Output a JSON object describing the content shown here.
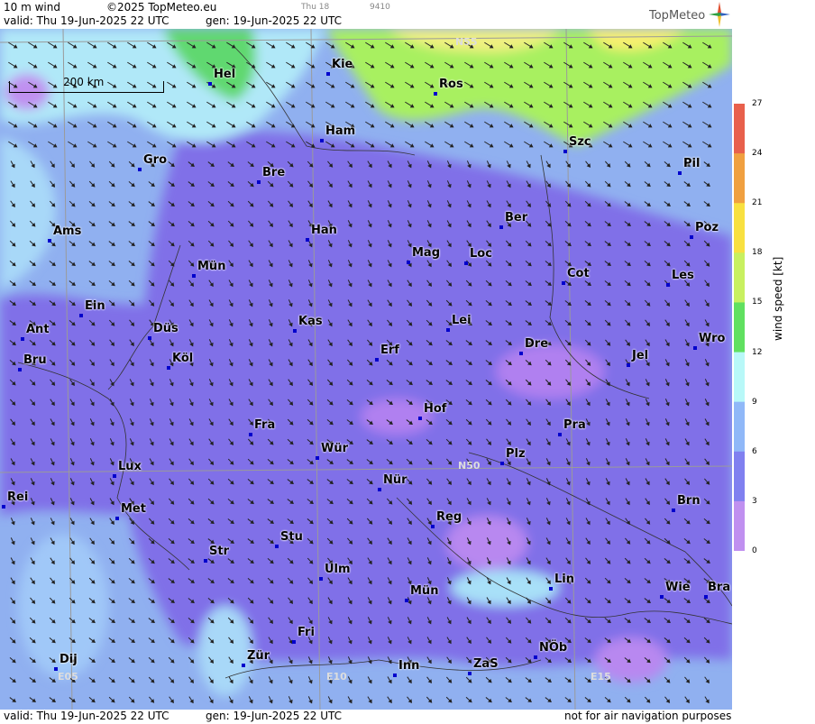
{
  "header": {
    "product": "10 m wind",
    "copyright": "©2025 TopMeteo.eu",
    "run_small": "Thu 18",
    "code_small": "9410",
    "valid": "valid:  Thu  19-Jun-2025  22 UTC",
    "gen": "gen: 19-Jun-2025 22 UTC",
    "brand": "TopMeteo"
  },
  "footer": {
    "valid": "valid:  Thu  19-Jun-2025  22 UTC",
    "gen": "gen: 19-Jun-2025 22 UTC",
    "disclaimer": "not for air navigation purposes"
  },
  "scale": {
    "label": "200 km"
  },
  "grid_labels": {
    "n55": "N55",
    "n50": "N50",
    "e05": "E05",
    "e10": "E10",
    "e15": "E15"
  },
  "legend": {
    "title": "wind speed  [kt]",
    "ticks": [
      "27",
      "24",
      "21",
      "18",
      "15",
      "12",
      "9",
      "6",
      "3",
      "0"
    ],
    "colors": [
      "#e8604c",
      "#f0a040",
      "#f8e040",
      "#c8f060",
      "#60e060",
      "#b8f8f8",
      "#90b8f8",
      "#8080f0",
      "#c090f0"
    ]
  },
  "cities": [
    {
      "name": "Hel"
    },
    {
      "name": "Kie"
    },
    {
      "name": "Ros"
    },
    {
      "name": "Ham"
    },
    {
      "name": "Szc"
    },
    {
      "name": "Gro"
    },
    {
      "name": "Bre"
    },
    {
      "name": "Pil"
    },
    {
      "name": "Ber"
    },
    {
      "name": "Ams"
    },
    {
      "name": "Han"
    },
    {
      "name": "Poz"
    },
    {
      "name": "Mag"
    },
    {
      "name": "Loc"
    },
    {
      "name": "Mün"
    },
    {
      "name": "Cot"
    },
    {
      "name": "Les"
    },
    {
      "name": "Ein"
    },
    {
      "name": "Kas"
    },
    {
      "name": "Lei"
    },
    {
      "name": "Ant"
    },
    {
      "name": "Düs"
    },
    {
      "name": "Wro"
    },
    {
      "name": "Dre"
    },
    {
      "name": "Bru"
    },
    {
      "name": "Köl"
    },
    {
      "name": "Erf"
    },
    {
      "name": "Jel"
    },
    {
      "name": "Hof"
    },
    {
      "name": "Fra"
    },
    {
      "name": "Pra"
    },
    {
      "name": "Wür"
    },
    {
      "name": "Plz"
    },
    {
      "name": "Lux"
    },
    {
      "name": "Nür"
    },
    {
      "name": "Rei"
    },
    {
      "name": "Met"
    },
    {
      "name": "Brn"
    },
    {
      "name": "Reg"
    },
    {
      "name": "Stu"
    },
    {
      "name": "Str"
    },
    {
      "name": "Ulm"
    },
    {
      "name": "Lin"
    },
    {
      "name": "Wie"
    },
    {
      "name": "Bra"
    },
    {
      "name": "Mün"
    },
    {
      "name": "Fri"
    },
    {
      "name": "NÖb"
    },
    {
      "name": "Dij"
    },
    {
      "name": "Zür"
    },
    {
      "name": "Inn"
    },
    {
      "name": "ZaS"
    }
  ]
}
